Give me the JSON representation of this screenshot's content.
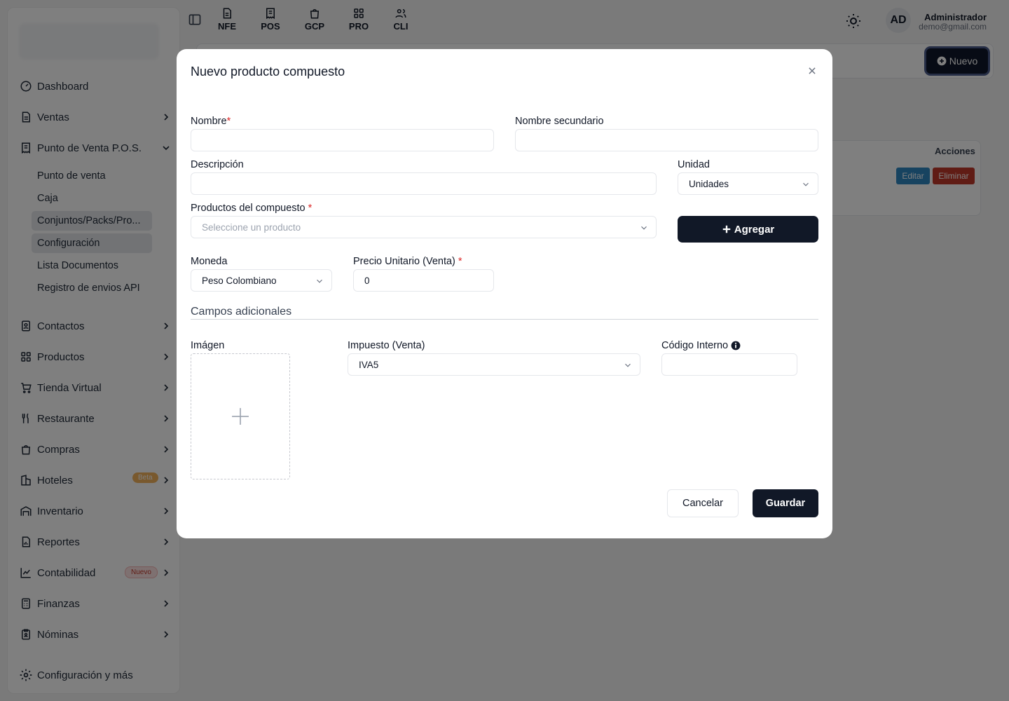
{
  "topbar": {
    "shortcuts": [
      {
        "label": "NFE",
        "icon": "document-icon"
      },
      {
        "label": "POS",
        "icon": "receipt-icon"
      },
      {
        "label": "GCP",
        "icon": "bag-icon"
      },
      {
        "label": "PRO",
        "icon": "grid-icon"
      },
      {
        "label": "CLI",
        "icon": "users-icon"
      }
    ],
    "avatar_initials": "AD",
    "user_name": "Administrador",
    "user_email": "demo@gmail.com"
  },
  "sidebar": {
    "items": [
      {
        "label": "Dashboard",
        "icon": "dashboard-icon"
      },
      {
        "label": "Ventas",
        "icon": "file-icon"
      },
      {
        "label": "Punto de Venta P.O.S.",
        "icon": "receipt-icon"
      },
      {
        "label": "Contactos",
        "icon": "contacts-icon"
      },
      {
        "label": "Productos",
        "icon": "grid-icon"
      },
      {
        "label": "Tienda Virtual",
        "icon": "cart-icon"
      },
      {
        "label": "Restaurante",
        "icon": "utensils-icon"
      },
      {
        "label": "Compras",
        "icon": "bag-icon"
      },
      {
        "label": "Hoteles",
        "icon": "building-icon"
      },
      {
        "label": "Inventario",
        "icon": "warehouse-icon"
      },
      {
        "label": "Reportes",
        "icon": "report-icon"
      },
      {
        "label": "Contabilidad",
        "icon": "chart-icon"
      },
      {
        "label": "Finanzas",
        "icon": "calculator-icon"
      },
      {
        "label": "Nóminas",
        "icon": "clipboard-icon"
      }
    ],
    "pos_subitems": [
      "Punto de venta",
      "Caja",
      "Conjuntos/Packs/Pro...",
      "Configuración",
      "Lista Documentos",
      "Registro de envios API"
    ],
    "badge_beta": "Beta",
    "badge_new": "Nuevo",
    "settings_label": "Configuración y más"
  },
  "page": {
    "new_button": "Nuevo",
    "actions_header": "Acciones",
    "edit_button": "Editar",
    "delete_button": "Eliminar"
  },
  "modal": {
    "title": "Nuevo producto compuesto",
    "name_label": "Nombre",
    "name_value": "",
    "secondary_name_label": "Nombre secundario",
    "secondary_name_value": "",
    "description_label": "Descripción",
    "description_value": "",
    "unit_label": "Unidad",
    "unit_value": "Unidades",
    "products_label": "Productos del compuesto",
    "products_placeholder": "Seleccione un producto",
    "add_button": "Agregar",
    "currency_label": "Moneda",
    "currency_value": "Peso Colombiano",
    "price_label": "Precio Unitario (Venta)",
    "price_value": "0",
    "additional_section": "Campos adicionales",
    "image_label": "Imágen",
    "tax_label": "Impuesto (Venta)",
    "tax_value": "IVA5",
    "internal_code_label": "Código Interno",
    "internal_code_value": "",
    "cancel_button": "Cancelar",
    "save_button": "Guardar",
    "required_mark": "*"
  },
  "colors": {
    "primary_dark": "#111827",
    "danger": "#dc2626",
    "overlay": "rgba(0,0,0,0.5)"
  }
}
